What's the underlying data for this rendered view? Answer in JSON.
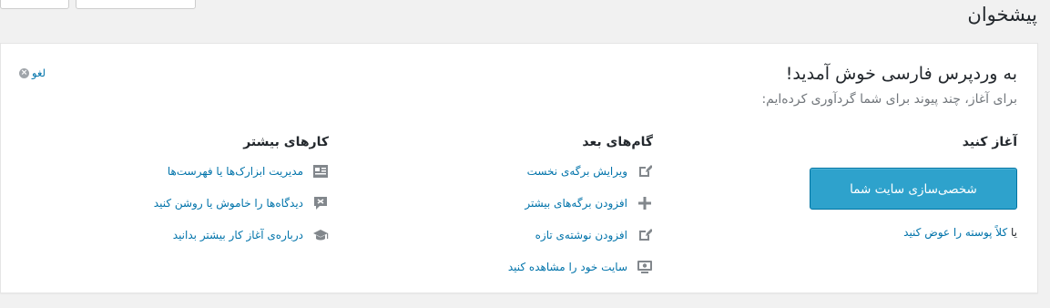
{
  "page": {
    "title": "پیشخوان"
  },
  "welcome": {
    "title": "به وردپرس فارسی خوش آمدید!",
    "subtitle": "برای آغاز، چند پیوند برای شما گردآوری کرده‌ایم:",
    "dismiss_label": "لغو",
    "colors": {
      "link": "#0073aa",
      "button": "#2ea2cc",
      "icon": "#82878c"
    },
    "start": {
      "heading": "آغاز کنید",
      "button_label": "شخصی‌سازی سایت شما",
      "alt_prefix": "یا",
      "alt_link": "کلاً پوسته را عوض کنید"
    },
    "next_steps": {
      "heading": "گام‌های بعد",
      "items": [
        {
          "label": "ویرایش برگه‌ی نخست",
          "icon": "edit-icon"
        },
        {
          "label": "افزودن برگه‌های بیشتر",
          "icon": "plus-icon"
        },
        {
          "label": "افزودن نوشته‌ی تازه",
          "icon": "edit-icon"
        },
        {
          "label": "سایت خود را مشاهده کنید",
          "icon": "view-site-icon"
        }
      ]
    },
    "more_actions": {
      "heading": "کارهای بیشتر",
      "items": [
        {
          "label": "مدیریت ابزارک‌ها یا فهرست‌ها",
          "icon": "widgets-icon"
        },
        {
          "label": "دیدگاه‌ها را خاموش یا روشن کنید",
          "icon": "comments-icon"
        },
        {
          "label": "درباره‌ی آغاز کار بیشتر بدانید",
          "icon": "learn-icon"
        }
      ]
    }
  }
}
